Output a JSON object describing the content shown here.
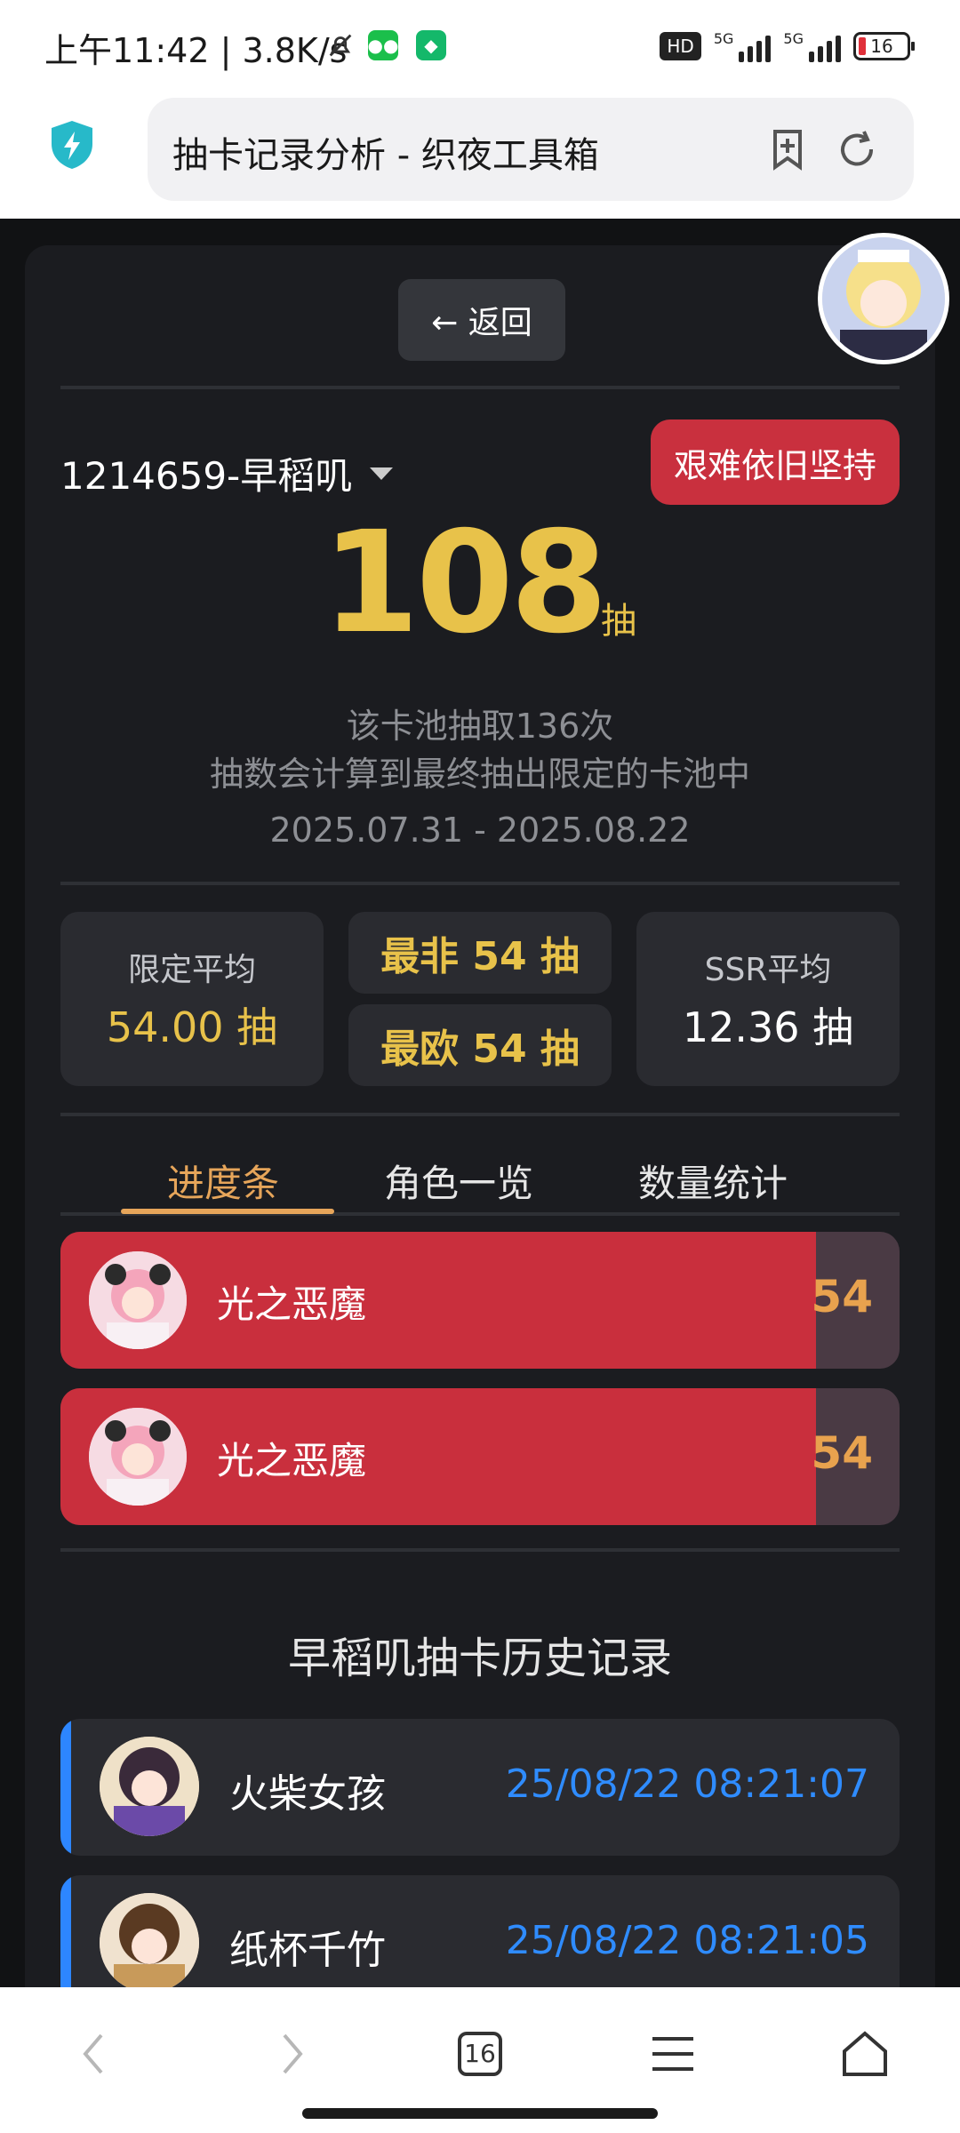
{
  "status_bar": {
    "time": "上午11:42 | 3.8K/s",
    "hd_label": "HD",
    "net1": "5G",
    "net2": "5G",
    "battery": "16",
    "icons": [
      "bell-off-icon",
      "wechat-icon",
      "app-notification-icon"
    ]
  },
  "browser": {
    "url_title": "抽卡记录分析 - 织夜工具箱",
    "tab_count": "16"
  },
  "page": {
    "back_label": "← 返回",
    "account": "1214659-早稻叽",
    "status_badge": "艰难依旧坚持",
    "total_pulls": "108",
    "pull_unit": "抽",
    "pool_count": "该卡池抽取136次",
    "note": "抽数会计算到最终抽出限定的卡池中",
    "date_range": "2025.07.31 - 2025.08.22",
    "stats": {
      "limited_avg_label": "限定平均",
      "limited_avg_value": "54.00 抽",
      "worst": "最非 54 抽",
      "best": "最欧 54 抽",
      "ssr_avg_label": "SSR平均",
      "ssr_avg_value": "12.36 抽"
    },
    "tabs": [
      "进度条",
      "角色一览",
      "数量统计"
    ],
    "progress": [
      {
        "name": "光之恶魔",
        "count": "54",
        "fill": 0.9
      },
      {
        "name": "光之恶魔",
        "count": "54",
        "fill": 0.9
      }
    ],
    "history_title": "早稻叽抽卡历史记录",
    "history": [
      {
        "name": "火柴女孩",
        "time": "25/08/22 08:21:07"
      },
      {
        "name": "纸杯千竹",
        "time": "25/08/22 08:21:05"
      }
    ]
  },
  "colors": {
    "accent_gold": "#e8c24a",
    "badge_red": "#c9303e",
    "progress_red": "#c92f3d",
    "history_blue": "#2f8cff",
    "tab_active": "#e6a55a"
  }
}
